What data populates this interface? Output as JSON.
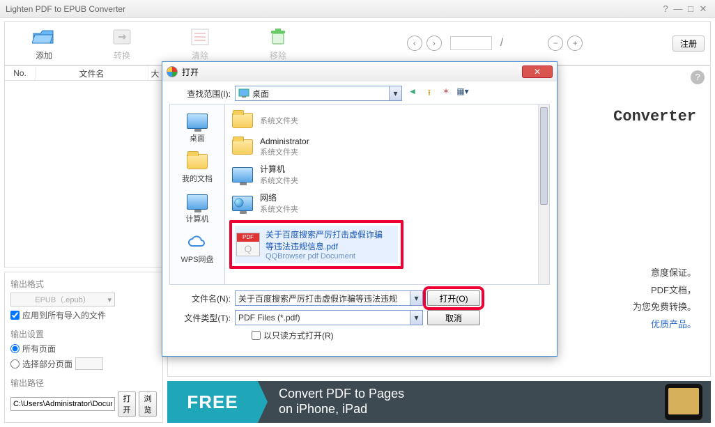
{
  "titlebar": {
    "title": "Lighten PDF to EPUB Converter"
  },
  "toolbar": {
    "add": "添加",
    "convert": "转换",
    "clear": "清除",
    "remove": "移除",
    "page_sep": "/",
    "register": "注册"
  },
  "table": {
    "no": "No.",
    "name": "文件名",
    "last": "大"
  },
  "settings": {
    "output_format_lbl": "输出格式",
    "output_format_value": "EPUB（.epub）",
    "apply_all": "应用到所有导入的文件",
    "output_settings_lbl": "输出设置",
    "all_pages": "所有页面",
    "partial_pages": "选择部分页面",
    "output_path_lbl": "输出路径",
    "path_value": "C:\\Users\\Administrator\\Documents\\Lighten PDF to EPUB Converter",
    "open_btn": "打开",
    "browse_btn": "浏览"
  },
  "preview": {
    "heading_fragment": "Converter",
    "line1": "意度保证。",
    "line2": "PDF文档，",
    "line3": "为您免费转换。",
    "link": "优质产品。"
  },
  "banner": {
    "free": "FREE",
    "text1": "Convert PDF to Pages",
    "text2": "on iPhone, iPad"
  },
  "dialog": {
    "title": "打开",
    "lookin_lbl": "查找范围(I):",
    "lookin_value": "桌面",
    "places": {
      "desktop": "桌面",
      "mydocs": "我的文档",
      "computer": "计算机",
      "wps": "WPS网盘"
    },
    "items": [
      {
        "name": "",
        "type": "系统文件夹",
        "kind": "folder-plain"
      },
      {
        "name": "Administrator",
        "type": "系统文件夹",
        "kind": "folder"
      },
      {
        "name": "计算机",
        "type": "系统文件夹",
        "kind": "computer"
      },
      {
        "name": "网络",
        "type": "系统文件夹",
        "kind": "network"
      }
    ],
    "selected_item": {
      "name_line1": "关于百度搜索严厉打击虚假诈骗",
      "name_line2": "等违法违规信息.pdf",
      "type": "QQBrowser pdf Document"
    },
    "filename_lbl": "文件名(N):",
    "filename_value": "关于百度搜索严厉打击虚假诈骗等违法违规",
    "filetype_lbl": "文件类型(T):",
    "filetype_value": "PDF Files (*.pdf)",
    "readonly": "以只读方式打开(R)",
    "open_btn": "打开(O)",
    "cancel_btn": "取消"
  }
}
